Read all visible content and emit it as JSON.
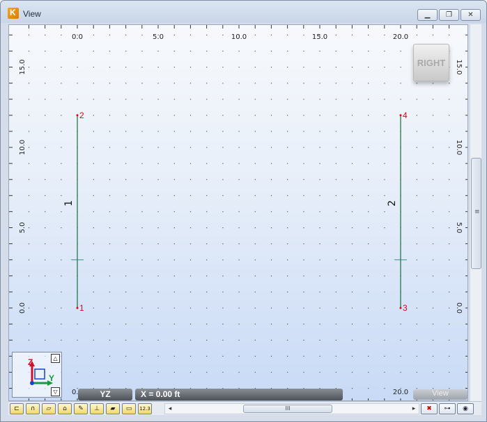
{
  "window": {
    "title": "View"
  },
  "view": {
    "nav_cube_label": "RIGHT",
    "plane_label": "YZ",
    "slice_label": "X = 0.00 ft",
    "view_label": "View"
  },
  "grid": {
    "x_ticks": [
      "0.0",
      "5.0",
      "10.0",
      "15.0",
      "20.0"
    ],
    "z_ticks": [
      "15.0",
      "10.0",
      "5.0",
      "0.0"
    ]
  },
  "model": {
    "nodes": [
      {
        "id": "1",
        "y": 0,
        "z": 0
      },
      {
        "id": "2",
        "y": 0,
        "z": 12
      },
      {
        "id": "3",
        "y": 20,
        "z": 0
      },
      {
        "id": "4",
        "y": 20,
        "z": 12
      }
    ],
    "members": [
      {
        "id": "1",
        "from": "1",
        "to": "2"
      },
      {
        "id": "2",
        "from": "3",
        "to": "4"
      }
    ],
    "colors": {
      "node_label": "#e0001b",
      "member": "#1b6b3a",
      "axis_z": "#d0102a",
      "axis_y": "#159a3c",
      "axis_x": "#1b3fd0"
    }
  },
  "axis_widget": {
    "z_label": "Z",
    "y_label": "Y"
  },
  "toolbar": {
    "tools": [
      "frame-icon",
      "arch-icon",
      "extrude-icon",
      "roof-icon",
      "pencil-icon",
      "support-icon",
      "plate-icon",
      "panel-icon",
      "numbering-icon"
    ],
    "numbering_label": "12.3",
    "right_tools": [
      "delete-icon",
      "link-icon",
      "eye-icon"
    ],
    "scroll_grip": "III"
  }
}
